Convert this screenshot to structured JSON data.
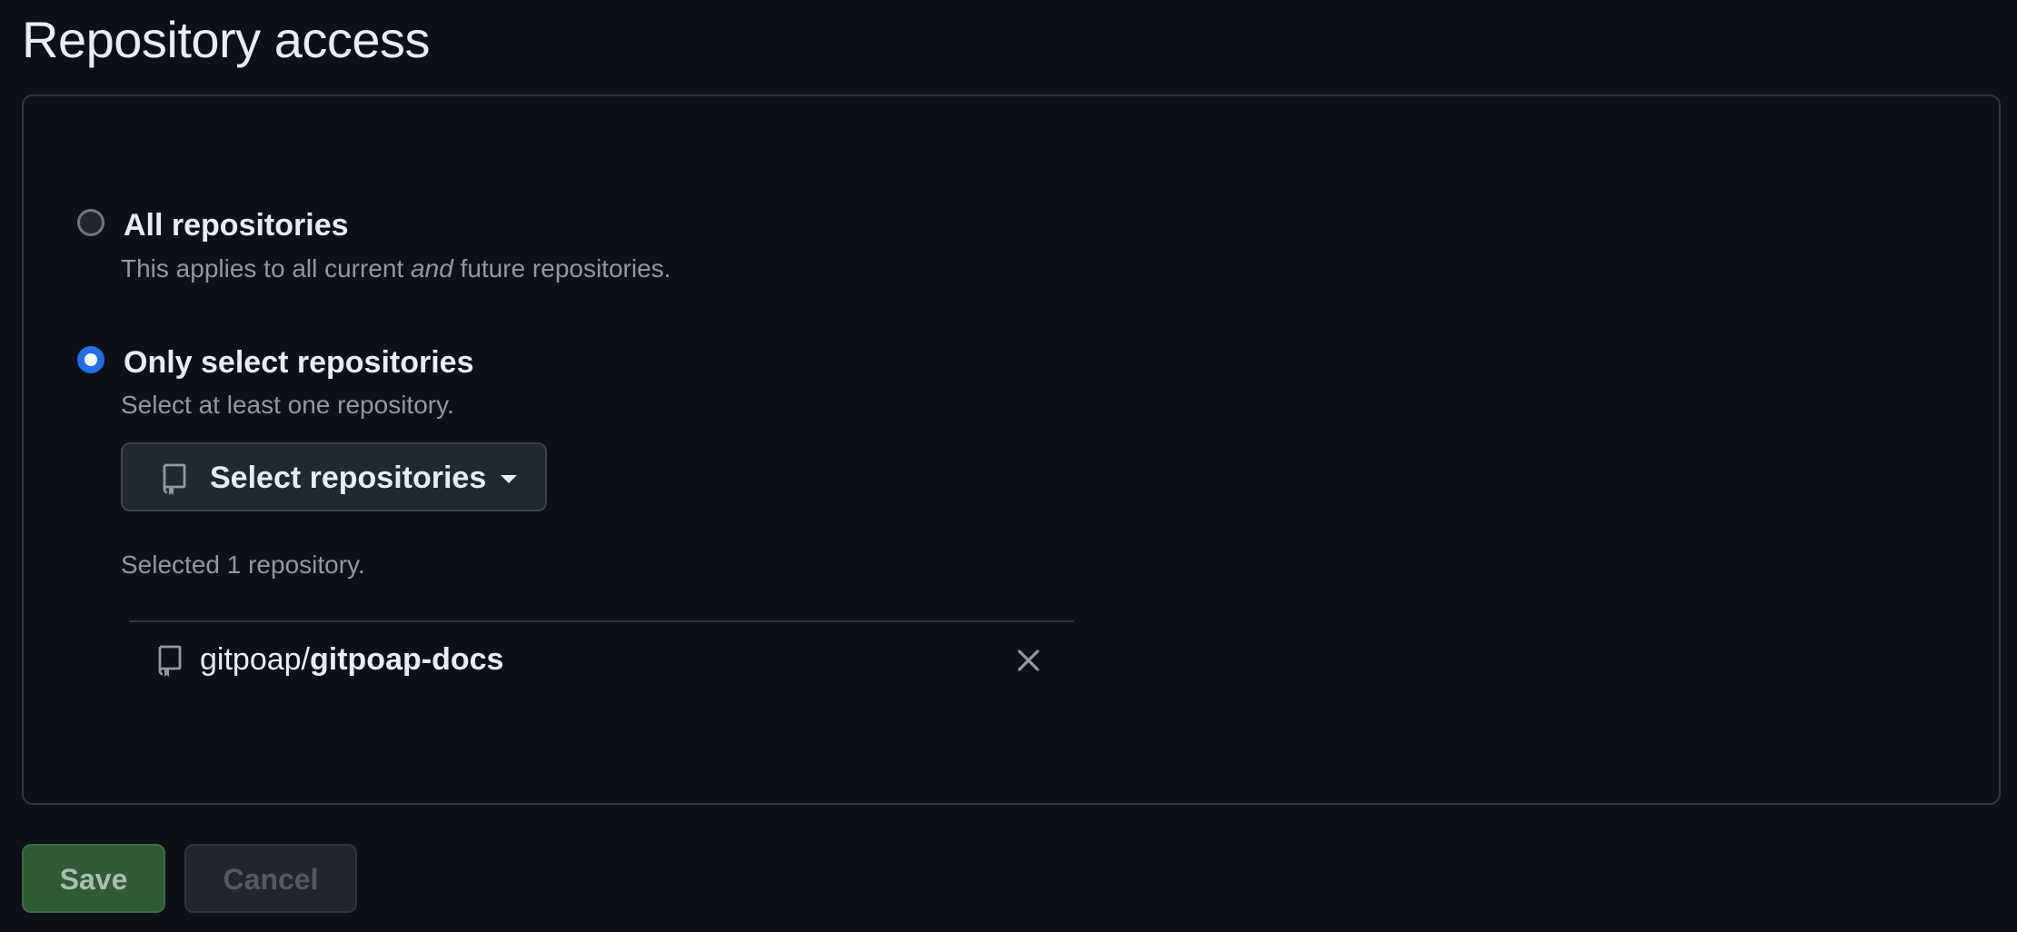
{
  "title": "Repository access",
  "options": {
    "all": {
      "label": "All repositories",
      "desc_before": "This applies to all current ",
      "desc_em": "and",
      "desc_after": " future repositories.",
      "checked": false
    },
    "select": {
      "label": "Only select repositories",
      "desc": "Select at least one repository.",
      "checked": true
    }
  },
  "select_button": {
    "label": "Select repositories",
    "icon": "repo-icon"
  },
  "selected_count": "Selected 1 repository.",
  "repositories": [
    {
      "owner": "gitpoap/",
      "name": "gitpoap-docs",
      "icon": "repo-icon"
    }
  ],
  "actions": {
    "save_label": "Save",
    "cancel_label": "Cancel"
  },
  "colors": {
    "background": "#0d1117",
    "radio_checked": "#1f6feb",
    "save_button": "#2f5a36"
  }
}
